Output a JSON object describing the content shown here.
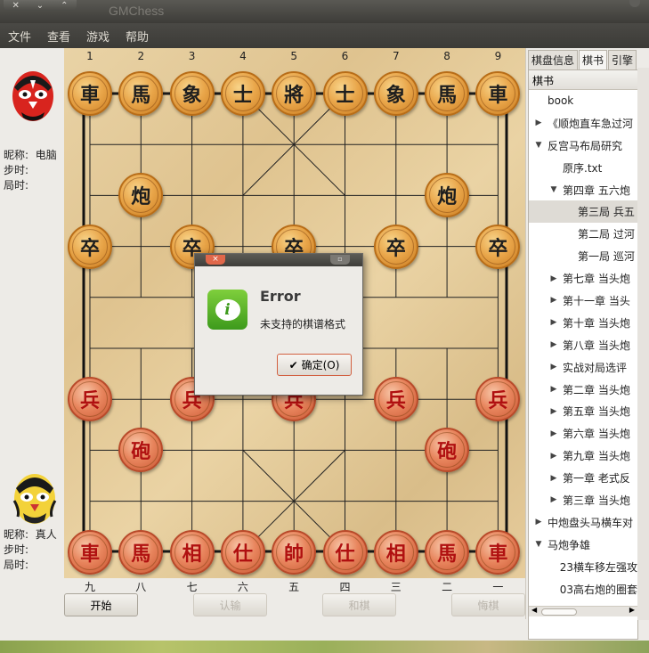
{
  "window": {
    "title": "GMChess"
  },
  "menu": [
    "文件",
    "查看",
    "游戏",
    "帮助"
  ],
  "players": {
    "top": {
      "nick_label": "昵称:",
      "nick_value": "电脑",
      "steps_label": "步时:",
      "time_label": "局时:"
    },
    "bottom": {
      "nick_label": "昵称:",
      "nick_value": "真人",
      "steps_label": "步时:",
      "time_label": "局时:"
    }
  },
  "board": {
    "top_labels": [
      "1",
      "2",
      "3",
      "4",
      "5",
      "6",
      "7",
      "8",
      "9"
    ],
    "bottom_labels": [
      "九",
      "八",
      "七",
      "六",
      "五",
      "四",
      "三",
      "二",
      "一"
    ],
    "pieces": [
      {
        "c": "車",
        "side": "black",
        "col": 0,
        "row": 0
      },
      {
        "c": "馬",
        "side": "black",
        "col": 1,
        "row": 0
      },
      {
        "c": "象",
        "side": "black",
        "col": 2,
        "row": 0
      },
      {
        "c": "士",
        "side": "black",
        "col": 3,
        "row": 0
      },
      {
        "c": "將",
        "side": "black",
        "col": 4,
        "row": 0
      },
      {
        "c": "士",
        "side": "black",
        "col": 5,
        "row": 0
      },
      {
        "c": "象",
        "side": "black",
        "col": 6,
        "row": 0
      },
      {
        "c": "馬",
        "side": "black",
        "col": 7,
        "row": 0
      },
      {
        "c": "車",
        "side": "black",
        "col": 8,
        "row": 0
      },
      {
        "c": "炮",
        "side": "black",
        "col": 1,
        "row": 2
      },
      {
        "c": "炮",
        "side": "black",
        "col": 7,
        "row": 2
      },
      {
        "c": "卒",
        "side": "black",
        "col": 0,
        "row": 3
      },
      {
        "c": "卒",
        "side": "black",
        "col": 2,
        "row": 3
      },
      {
        "c": "卒",
        "side": "black",
        "col": 4,
        "row": 3
      },
      {
        "c": "卒",
        "side": "black",
        "col": 6,
        "row": 3
      },
      {
        "c": "卒",
        "side": "black",
        "col": 8,
        "row": 3
      },
      {
        "c": "兵",
        "side": "red",
        "col": 0,
        "row": 6
      },
      {
        "c": "兵",
        "side": "red",
        "col": 2,
        "row": 6
      },
      {
        "c": "兵",
        "side": "red",
        "col": 4,
        "row": 6
      },
      {
        "c": "兵",
        "side": "red",
        "col": 6,
        "row": 6
      },
      {
        "c": "兵",
        "side": "red",
        "col": 8,
        "row": 6
      },
      {
        "c": "砲",
        "side": "red",
        "col": 1,
        "row": 7
      },
      {
        "c": "砲",
        "side": "red",
        "col": 7,
        "row": 7
      },
      {
        "c": "車",
        "side": "red",
        "col": 0,
        "row": 9
      },
      {
        "c": "馬",
        "side": "red",
        "col": 1,
        "row": 9
      },
      {
        "c": "相",
        "side": "red",
        "col": 2,
        "row": 9
      },
      {
        "c": "仕",
        "side": "red",
        "col": 3,
        "row": 9
      },
      {
        "c": "帥",
        "side": "red",
        "col": 4,
        "row": 9
      },
      {
        "c": "仕",
        "side": "red",
        "col": 5,
        "row": 9
      },
      {
        "c": "相",
        "side": "red",
        "col": 6,
        "row": 9
      },
      {
        "c": "馬",
        "side": "red",
        "col": 7,
        "row": 9
      },
      {
        "c": "車",
        "side": "red",
        "col": 8,
        "row": 9
      }
    ]
  },
  "buttons": {
    "start": "开始",
    "resign": "认输",
    "draw": "和棋",
    "undo": "悔棋"
  },
  "tabs": [
    "棋盘信息",
    "棋书",
    "引擎"
  ],
  "tree": {
    "header": "棋书",
    "items": [
      {
        "t": "book",
        "d": 0,
        "a": ""
      },
      {
        "t": "《顺炮直车急过河",
        "d": 0,
        "a": "▶"
      },
      {
        "t": "反宫马布局研究",
        "d": 0,
        "a": "▼"
      },
      {
        "t": "原序.txt",
        "d": 1,
        "a": ""
      },
      {
        "t": "第四章 五六炮",
        "d": 1,
        "a": "▼"
      },
      {
        "t": "第三局 兵五",
        "d": 2,
        "a": "",
        "sel": true
      },
      {
        "t": "第二局 过河",
        "d": 2,
        "a": ""
      },
      {
        "t": "第一局 巡河",
        "d": 2,
        "a": ""
      },
      {
        "t": "第七章 当头炮",
        "d": 1,
        "a": "▶"
      },
      {
        "t": "第十一章 当头",
        "d": 1,
        "a": "▶"
      },
      {
        "t": "第十章 当头炮",
        "d": 1,
        "a": "▶"
      },
      {
        "t": "第八章 当头炮",
        "d": 1,
        "a": "▶"
      },
      {
        "t": "实战对局选评",
        "d": 1,
        "a": "▶"
      },
      {
        "t": "第二章 当头炮",
        "d": 1,
        "a": "▶"
      },
      {
        "t": "第五章 当头炮",
        "d": 1,
        "a": "▶"
      },
      {
        "t": "第六章 当头炮",
        "d": 1,
        "a": "▶"
      },
      {
        "t": "第九章 当头炮",
        "d": 1,
        "a": "▶"
      },
      {
        "t": "第一章 老式反",
        "d": 1,
        "a": "▶"
      },
      {
        "t": "第三章 当头炮",
        "d": 1,
        "a": "▶"
      },
      {
        "t": "中炮盘头马横车对",
        "d": 0,
        "a": "▶"
      },
      {
        "t": "马炮争雄",
        "d": 0,
        "a": "▼"
      },
      {
        "t": "23横车移左强攻",
        "d": 1,
        "a": ""
      },
      {
        "t": "03高右炮的圈套",
        "d": 1,
        "a": ""
      }
    ]
  },
  "dialog": {
    "close": "×",
    "title": "Error",
    "message": "未支持的棋谱格式",
    "ok": "确定(O)"
  }
}
